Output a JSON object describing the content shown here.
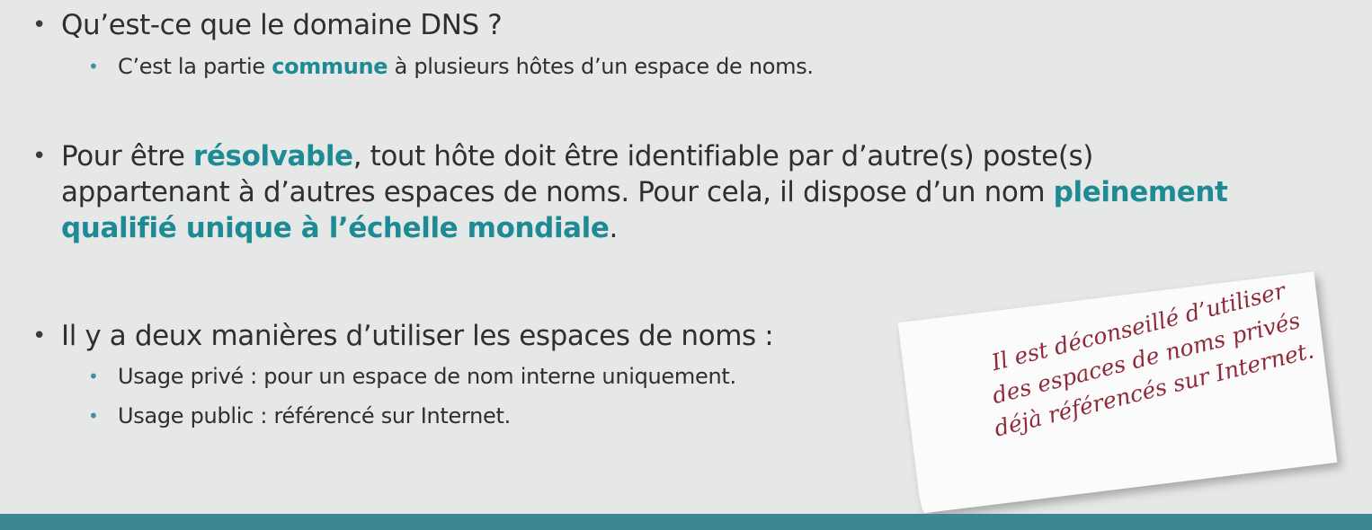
{
  "bullets": {
    "b1": {
      "marker": "•",
      "text": "Qu’est-ce que le domaine DNS ?"
    },
    "b1_sub": {
      "marker": "•",
      "prefix": "C’est la partie ",
      "emph": "commune",
      "suffix": " à plusieurs hôtes d’un espace de noms."
    },
    "b2": {
      "marker": "•",
      "prefix": "Pour être ",
      "emph1": "résolvable",
      "middle": ", tout hôte doit être identifiable par d’autre(s) poste(s) appartenant à d’autres espaces de noms. Pour cela, il dispose d’un nom ",
      "emph2": "pleinement qualifié unique à l’échelle mondiale",
      "suffix": "."
    },
    "b3": {
      "marker": "•",
      "text": "Il y a deux manières d’utiliser les espaces de noms :"
    },
    "b3_sub1": {
      "marker": "•",
      "text": "Usage privé : pour un espace de nom interne uniquement."
    },
    "b3_sub2": {
      "marker": "•",
      "text": "Usage public : référencé sur Internet."
    }
  },
  "note": {
    "line1": "Il est déconseillé d’utiliser",
    "line2": "des espaces de noms privés",
    "line3": "déjà référencés sur Internet."
  },
  "colors": {
    "accent": "#1d8a94",
    "bar": "#3b8794",
    "note_text": "#8e2a3a",
    "background": "#e6e7e7"
  }
}
